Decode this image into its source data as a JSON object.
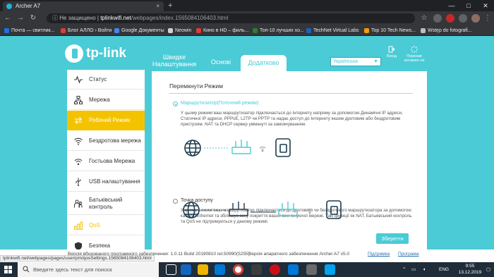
{
  "browser": {
    "tab_title": "Archer A7",
    "tab_close": "×",
    "new_tab": "+",
    "window_controls": [
      "—",
      "□",
      "✕"
    ],
    "address": {
      "security": "Не защищено",
      "separator": " | ",
      "host": "tplinkwifi.net",
      "path": "/webpages/index.1565084106403.html"
    },
    "bookmarks": [
      {
        "label": "Почта — свитлик...",
        "color": "#1a73e8"
      },
      {
        "label": "Блог АЛЛО › Войти",
        "color": "#e53935"
      },
      {
        "label": "Google Документы",
        "color": "#4285f4"
      },
      {
        "label": "Neowin",
        "color": "#d0d0d0"
      },
      {
        "label": "Кино в HD – филь...",
        "color": "#e53935"
      },
      {
        "label": "Топ-10 лучших хо...",
        "color": "#2e7d32"
      },
      {
        "label": "TechNet Virtual Labs",
        "color": "#1565c0"
      },
      {
        "label": "Top 10 Tech News...",
        "color": "#ff9800"
      },
      {
        "label": "Wstęp do fotografi...",
        "color": "#bdbdbd"
      }
    ],
    "status_url": "tplinkwifi.net/webpages/pages/userrpm/qosSettings.1565084106403.html"
  },
  "header": {
    "logo_text": "tp-link",
    "tabs": {
      "quick": "Швидке Налаштування",
      "basic": "Основі",
      "advanced": "Додатково"
    },
    "language": "Українська",
    "logout": "Вихід",
    "reboot": "Перезав антажен ня"
  },
  "sidebar": {
    "items": [
      {
        "label": "Статус",
        "icon": "pulse-icon"
      },
      {
        "label": "Мережа",
        "icon": "network-icon"
      },
      {
        "label": "Робочий Режим",
        "icon": "mode-switch-icon"
      },
      {
        "label": "Бездротова мережа",
        "icon": "wifi-icon"
      },
      {
        "label": "Гостьова Мережа",
        "icon": "guest-network-icon"
      },
      {
        "label": "USB налаштування",
        "icon": "usb-icon"
      },
      {
        "label": "Батьківський контроль",
        "icon": "parental-control-icon"
      },
      {
        "label": "QoS",
        "icon": "qos-icon"
      },
      {
        "label": "Безпека",
        "icon": "shield-icon"
      }
    ]
  },
  "content": {
    "title": "Перемкнути Режим",
    "router_option": {
      "label": "Маршрутизатор(Поточний режим)",
      "description": "У цьому режимі ваш маршрутизатор підключається до Інтернету напряму за допомогою Динамічні IP адреси, Статичної IP адреси, PPPoE, L2TP чи PPTP та надає доступ до Інтернету іншим дротовим або бездротовим пристроям. NAT та DHCP сервер увімкнуті за замовчуванням.",
      "selected": true
    },
    "ap_option": {
      "label": "Точка доступу",
      "description": "У цьому режимі ваш маршрутизатор підключається до дротового чи бездротового маршрутизатора за допомогою кабелю Ethernet та збільшує зону покриття вашої вже існуючої мережі. Такі функції як NAT, Батьківський контроль та QoS не підтримуються у даному режимі.",
      "selected": false
    },
    "save_label": "Зберегти"
  },
  "footer": {
    "firmware": "Версія вбудованого програмного забезпечення: 1.0.11 Build 20190810 rel.50990(5255)",
    "hardware": "Версія апаратного забезпечення Archer A7 v5.0",
    "support": "Підтримка",
    "app": "Програма"
  },
  "taskbar": {
    "search_placeholder": "Введите здесь текст для поиска",
    "language": "ENG",
    "time": "9:55",
    "date": "13.12.2019"
  },
  "colors": {
    "brand": "#4acbd6",
    "active": "#f4c300"
  }
}
